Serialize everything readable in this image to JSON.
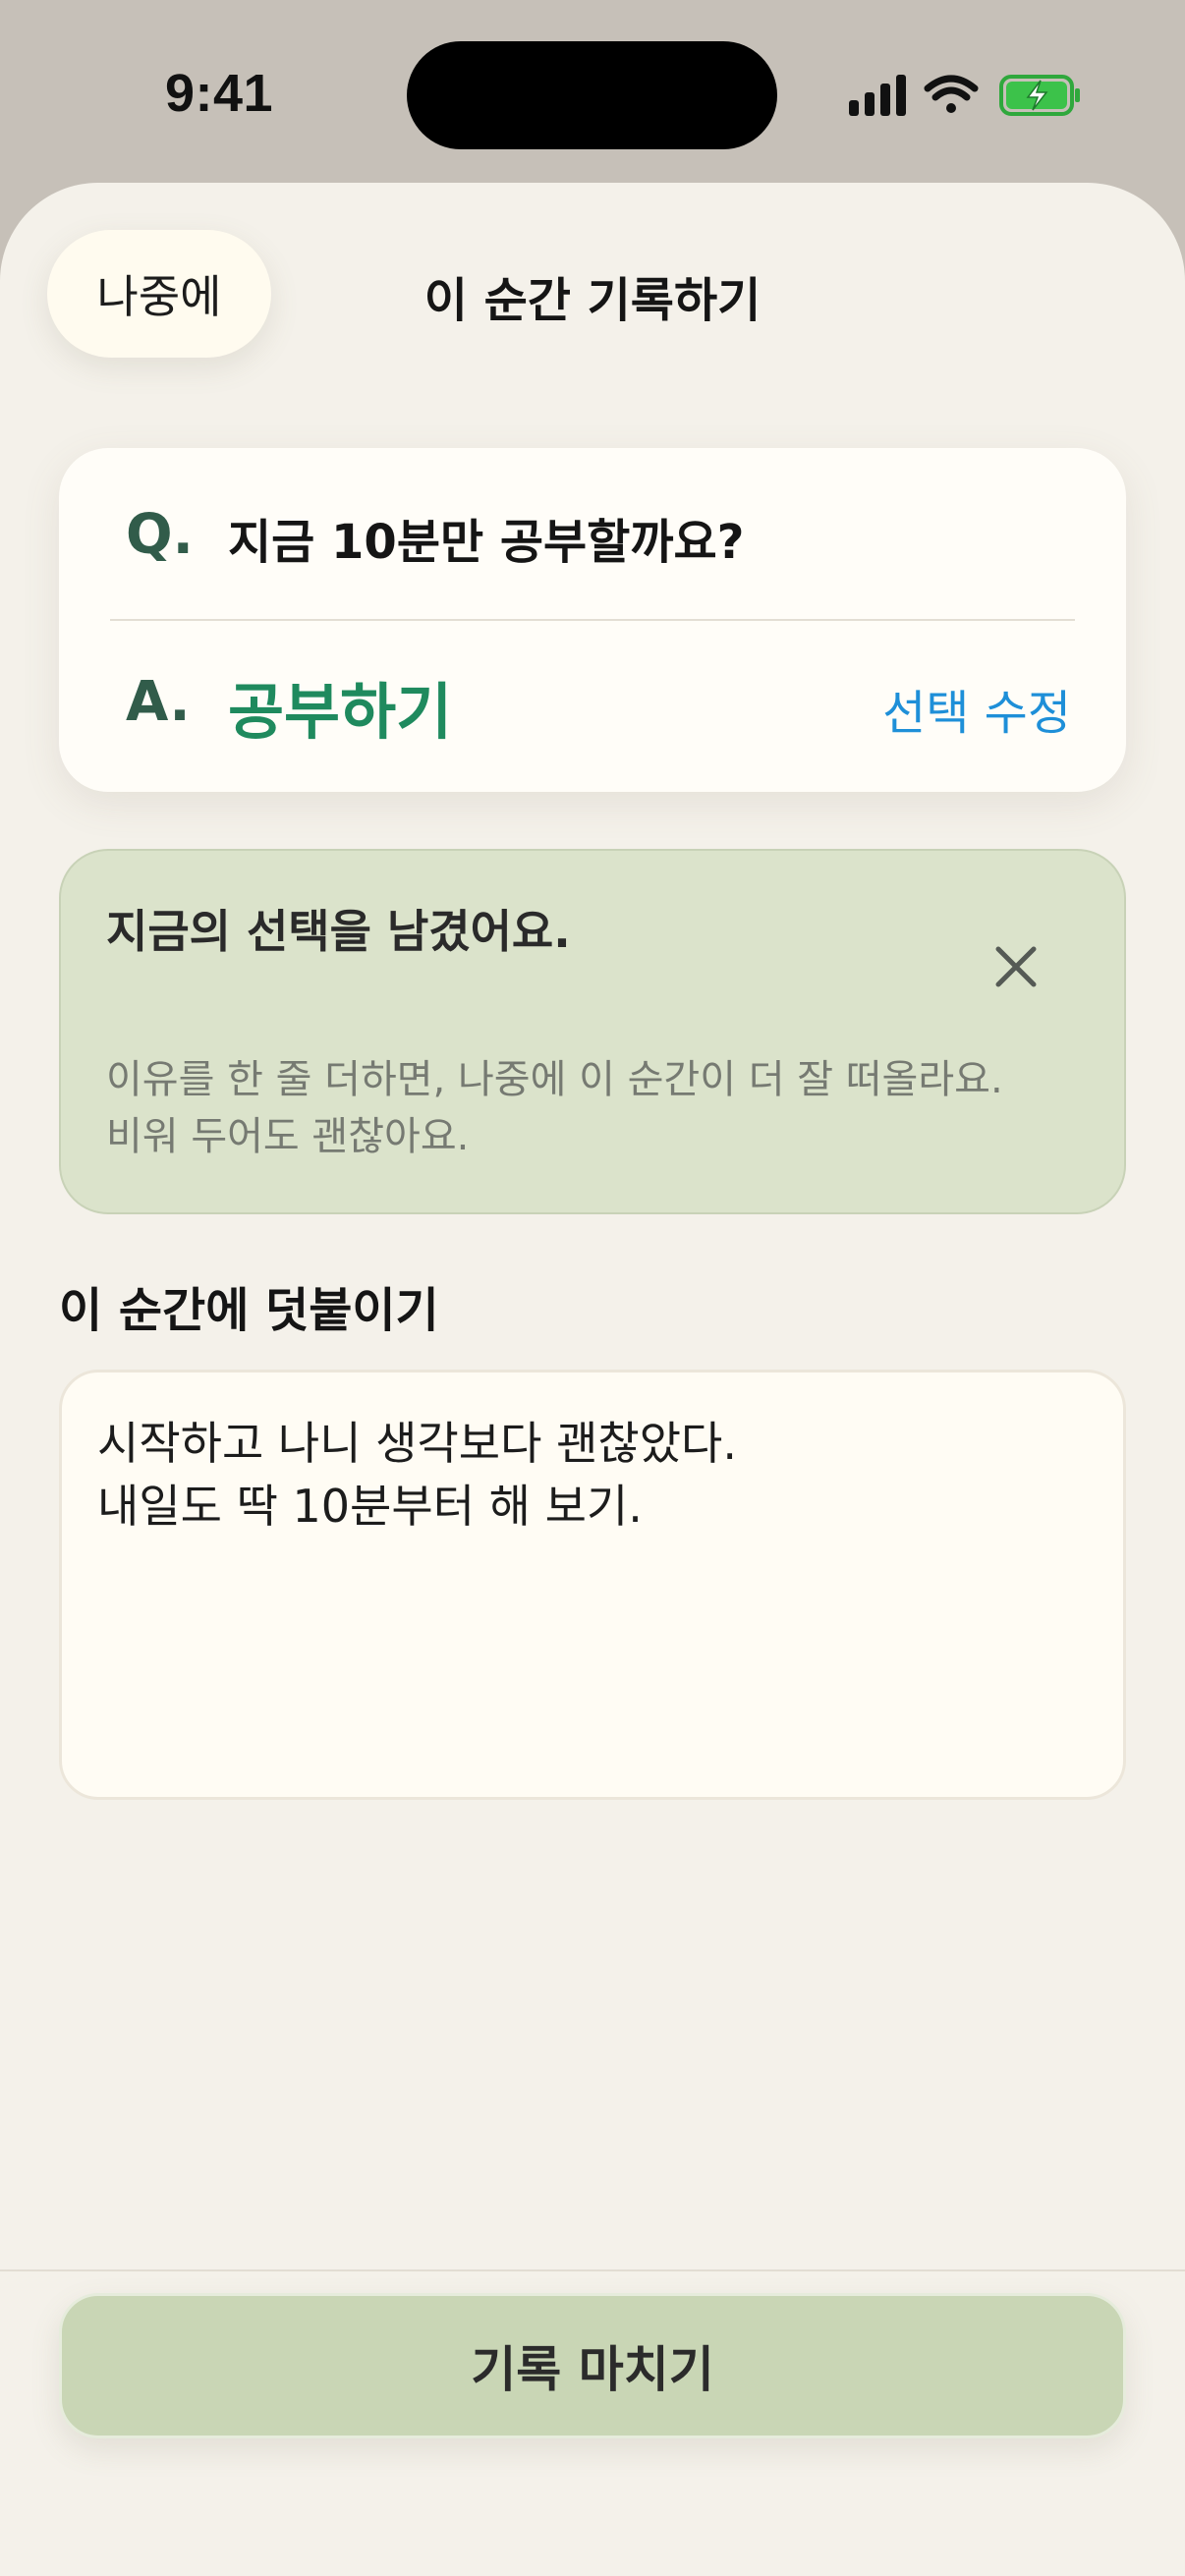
{
  "status_bar": {
    "time": "9:41",
    "icons": [
      "signal-icon",
      "wifi-icon",
      "battery-charging-icon"
    ],
    "battery_color": "#3cc24a"
  },
  "header": {
    "later_label": "나중에",
    "title": "이 순간 기록하기"
  },
  "qa_card": {
    "q_prefix": "Q.",
    "question": "지금 10분만 공부할까요?",
    "a_prefix": "A.",
    "answer": "공부하기",
    "edit_label": "선택 수정"
  },
  "notice": {
    "title": "지금의 선택을 남겼어요.",
    "body_lines": [
      "이유를 한 줄 더하면, 나중에 이 순간이 더 잘 떠올라요.",
      "비워 두어도 괜찮아요."
    ]
  },
  "note": {
    "section_label": "이 순간에 덧붙이기",
    "lines": [
      "시작하고 나니 생각보다 괜찮았다.",
      "내일도 딱 10분부터 해 보기."
    ]
  },
  "footer": {
    "finish_label": "기록 마치기"
  },
  "colors": {
    "accent_green": "#1f8a5e",
    "link_blue": "#1e8fd8",
    "notice_bg": "#dbe3cb",
    "finish_bg": "#c9d6b5"
  }
}
